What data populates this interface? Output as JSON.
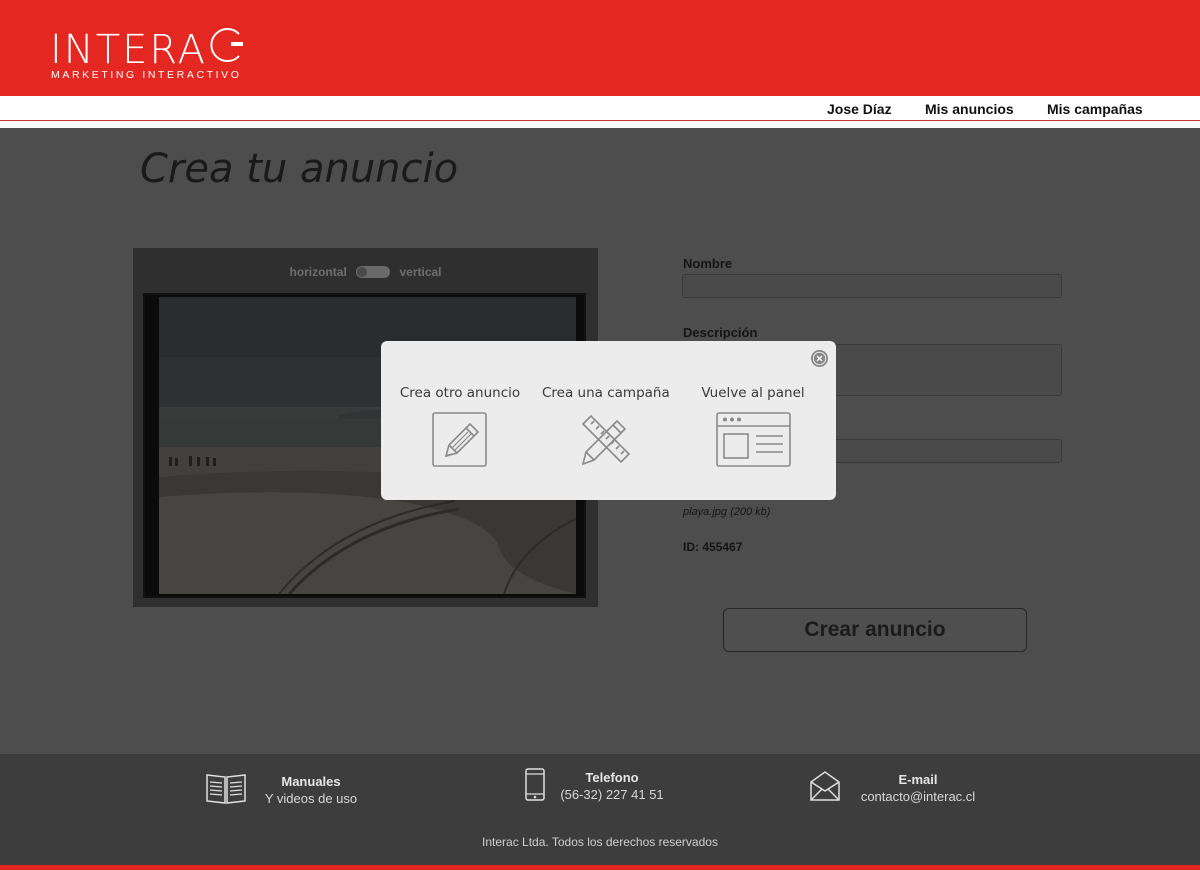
{
  "brand": {
    "name": "INTERA",
    "tagline": "MARKETING INTERACTIVO",
    "color": "#e52722"
  },
  "nav": {
    "items": [
      {
        "label": "Jose Díaz"
      },
      {
        "label": "Mis anuncios"
      },
      {
        "label": "Mis campañas"
      }
    ]
  },
  "main": {
    "title": "Crea tu anuncio",
    "orientation": {
      "left": "horizontal",
      "right": "vertical",
      "selected": "horizontal"
    },
    "form": {
      "name_label": "Nombre",
      "name_value": "",
      "description_label": "Descripción",
      "description_value": "",
      "file_value": "",
      "file_name": "playa.jpg (200 kb)",
      "id_text": "ID: 455467"
    },
    "create_button": "Crear anuncio"
  },
  "modal": {
    "options": [
      {
        "label": "Crea otro anuncio",
        "icon": "edit-icon"
      },
      {
        "label": "Crea una campaña",
        "icon": "pencil-ruler-icon"
      },
      {
        "label": "Vuelve al panel",
        "icon": "browser-panel-icon"
      }
    ]
  },
  "footer": {
    "manuals": {
      "title": "Manuales",
      "subtitle": "Y videos de uso"
    },
    "phone": {
      "title": "Telefono",
      "subtitle": "(56-32) 227 41 51"
    },
    "email": {
      "title": "E-mail",
      "subtitle": "contacto@interac.cl"
    },
    "copyright": "Interac Ltda. Todos los derechos reservados"
  }
}
